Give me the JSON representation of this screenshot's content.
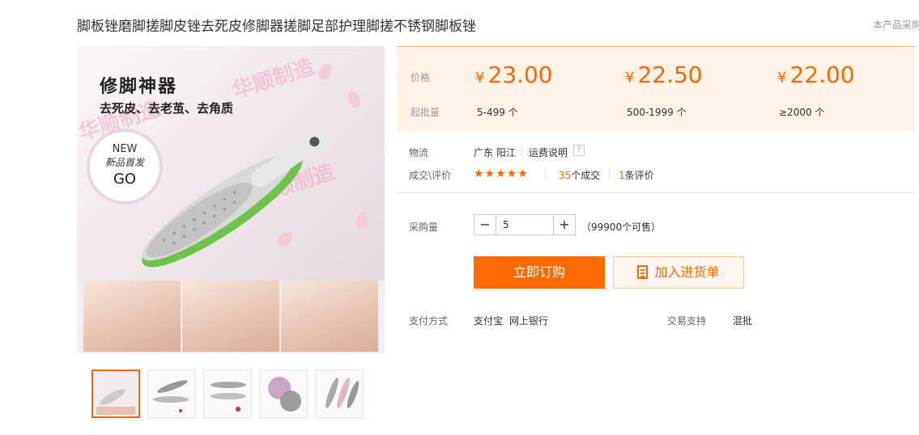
{
  "title": "脚板锉磨脚搓脚皮锉去死皮修脚器搓脚足部护理脚搓不锈钢脚板锉",
  "notice": "本产品采购",
  "image": {
    "headline": "修脚神器",
    "subline": "去死皮、去老茧、去角质",
    "watermark": "华顺制造",
    "badge": {
      "new": "NEW",
      "cn": "新品首发",
      "go": "GO"
    }
  },
  "thumbnails": 5,
  "price": {
    "label": "价格",
    "currency": "¥",
    "tiers": [
      {
        "price": "23.00",
        "qty": "5-499 个"
      },
      {
        "price": "22.50",
        "qty": "500-1999 个"
      },
      {
        "price": "22.00",
        "qty": "≥2000 个"
      }
    ],
    "qty_label": "起批量"
  },
  "logistics": {
    "label": "物流",
    "location": "广东 阳江",
    "shipping_link": "运费说明",
    "help": "?"
  },
  "deals": {
    "label": "成交\\评价",
    "stars": "★★★★★",
    "count": "35",
    "count_suffix": "个成交",
    "reviews": "1",
    "reviews_suffix": "条评价"
  },
  "purchase": {
    "label": "采购量",
    "minus": "−",
    "plus": "+",
    "value": "5",
    "available": "（99900个可售）"
  },
  "buttons": {
    "buy": "立即订购",
    "cart": "加入进货单"
  },
  "payment": {
    "label": "支付方式",
    "methods": [
      "支付宝",
      "网上银行"
    ],
    "support_label": "交易支持",
    "support_value": "混批"
  },
  "colors": {
    "accent": "#ff6a00",
    "price_bg": "#fff3e8"
  }
}
